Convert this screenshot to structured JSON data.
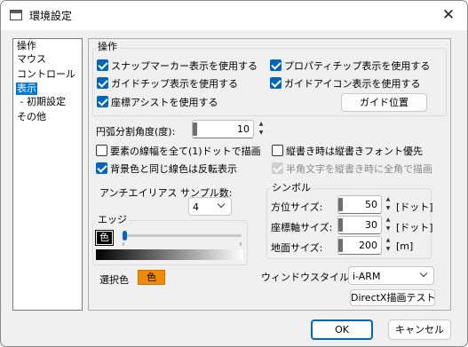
{
  "window": {
    "title": "環境設定",
    "close_glyph": "✕"
  },
  "nav": {
    "items": [
      {
        "label": "操作"
      },
      {
        "label": "マウス"
      },
      {
        "label": "コントロール"
      },
      {
        "label": "表示"
      },
      {
        "label": " - 初期設定"
      },
      {
        "label": "その他"
      }
    ],
    "selected_index": 3
  },
  "operation_group": {
    "title": "操作",
    "checkboxes": [
      {
        "label": "スナップマーカー表示を使用する",
        "checked": true
      },
      {
        "label": "プロパティチップ表示を使用する",
        "checked": true
      },
      {
        "label": "ガイドチップ表示を使用する",
        "checked": true
      },
      {
        "label": "ガイドアイコン表示を使用する",
        "checked": true
      },
      {
        "label": "座標アシストを使用する",
        "checked": true
      }
    ],
    "guide_position_button": "ガイド位置"
  },
  "arc_division": {
    "label": "円弧分割角度(度):",
    "value": "10"
  },
  "line_width_options": [
    {
      "label": "要素の線幅を全て(1)ドットで描画",
      "checked": false
    },
    {
      "label": "背景色と同じ線色は反転表示",
      "checked": true
    }
  ],
  "vertical_text_options": [
    {
      "label": "縦書き時は縦書きフォント優先",
      "checked": false,
      "enabled": true
    },
    {
      "label": "半角文字を縦書き時に全角で描画",
      "checked": true,
      "enabled": false
    }
  ],
  "antialias": {
    "label": "アンチエイリアス  サンプル数:",
    "value": "4"
  },
  "edge": {
    "title": "エッジ",
    "swatch_label": "色",
    "slider_fraction": 0.0
  },
  "selection_color": {
    "label": "選択色",
    "swatch_label": "色",
    "color": "#f28b00"
  },
  "symbol_group": {
    "title": "シンボル",
    "fields": [
      {
        "label": "方位サイズ:",
        "value": "50",
        "unit": "[ドット]"
      },
      {
        "label": "座標軸サイズ:",
        "value": "30",
        "unit": "[ドット]"
      },
      {
        "label": "地面サイズ:",
        "value": "200",
        "unit": "[m]"
      }
    ]
  },
  "window_style": {
    "label": "ウィンドウスタイル:",
    "value": "i-ARM"
  },
  "directx_test_button": "DirectX描画テスト",
  "ok_button": "OK",
  "cancel_button": "キャンセル",
  "colors": {
    "accent": "#0067c0",
    "selection_blue": "#0078d7",
    "orange": "#f28b00"
  }
}
